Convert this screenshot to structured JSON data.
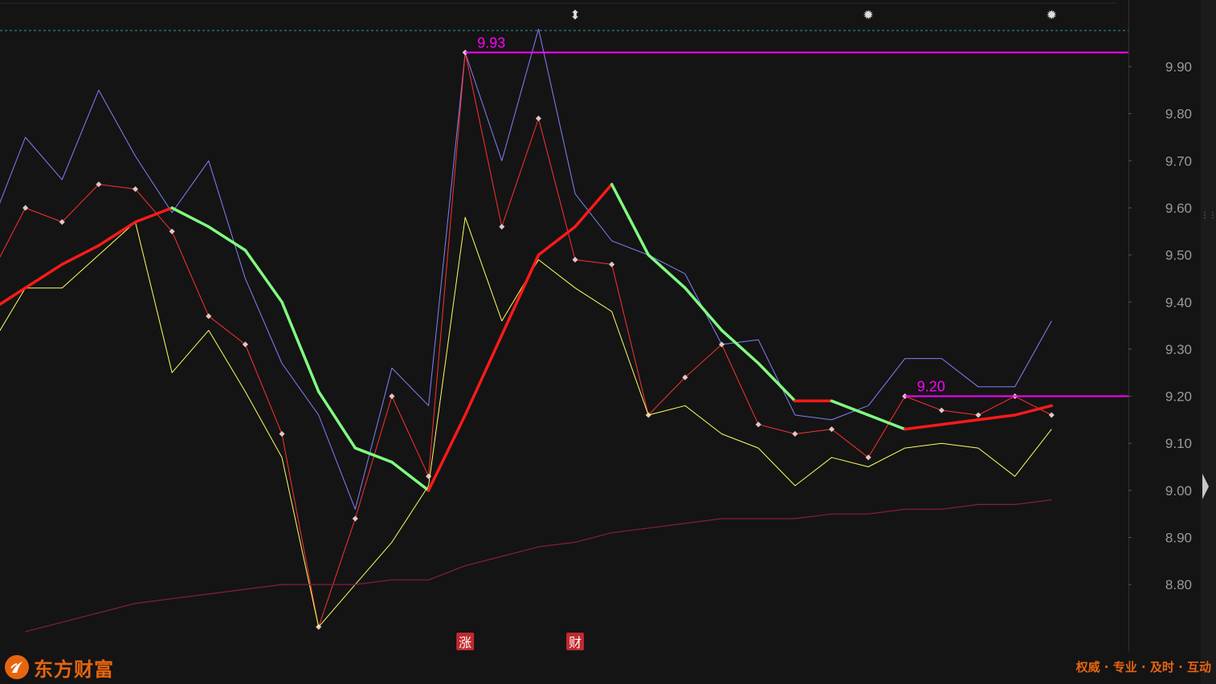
{
  "chart_data": {
    "type": "line",
    "ylim": [
      8.7,
      10.0
    ],
    "yticks": [
      "9.90",
      "9.80",
      "9.70",
      "9.60",
      "9.50",
      "9.40",
      "9.30",
      "9.20",
      "9.10",
      "9.00",
      "8.90",
      "8.80"
    ],
    "grid": false,
    "series": [
      {
        "color": "#8080ff",
        "width": 1,
        "values": [
          9.55,
          9.75,
          9.66,
          9.85,
          9.71,
          9.59,
          9.7,
          9.45,
          9.27,
          9.16,
          8.96,
          9.26,
          9.18,
          9.93,
          9.7,
          9.98,
          9.63,
          9.53,
          9.5,
          9.46,
          9.31,
          9.32,
          9.16,
          9.15,
          9.18,
          9.28,
          9.28,
          9.22,
          9.22,
          9.36
        ]
      },
      {
        "color": "#ff3030",
        "width": 1,
        "markers": true,
        "values": [
          9.45,
          9.6,
          9.57,
          9.65,
          9.64,
          9.55,
          9.37,
          9.31,
          9.12,
          8.71,
          8.94,
          9.2,
          9.03,
          9.93,
          9.56,
          9.79,
          9.49,
          9.48,
          9.16,
          9.24,
          9.31,
          9.14,
          9.12,
          9.13,
          9.07,
          9.2,
          9.17,
          9.16,
          9.2,
          9.16
        ]
      },
      {
        "color": "#ffff60",
        "width": 1,
        "values": [
          9.3,
          9.43,
          9.43,
          9.5,
          9.57,
          9.25,
          9.34,
          9.21,
          9.07,
          8.71,
          8.8,
          8.89,
          9.01,
          9.58,
          9.36,
          9.49,
          9.43,
          9.38,
          9.16,
          9.18,
          9.12,
          9.09,
          9.01,
          9.07,
          9.05,
          9.09,
          9.1,
          9.09,
          9.03,
          9.13
        ]
      },
      {
        "color": "#8a1a4a",
        "width": 1.2,
        "start": 1,
        "values": [
          null,
          8.7,
          8.72,
          8.74,
          8.76,
          8.77,
          8.78,
          8.79,
          8.8,
          8.8,
          8.8,
          8.81,
          8.81,
          8.84,
          8.86,
          8.88,
          8.89,
          8.91,
          8.92,
          8.93,
          8.94,
          8.94,
          8.94,
          8.95,
          8.95,
          8.96,
          8.96,
          8.97,
          8.97,
          8.98
        ]
      },
      {
        "type": "up-down",
        "up_color": "#ff1a1a",
        "down_color": "#80ff80",
        "width": 3.5,
        "values": [
          9.38,
          9.43,
          9.48,
          9.52,
          9.57,
          9.6,
          9.56,
          9.51,
          9.4,
          9.21,
          9.09,
          9.06,
          9.0,
          9.16,
          9.33,
          9.5,
          9.56,
          9.65,
          9.5,
          9.43,
          9.34,
          9.27,
          9.19,
          9.19,
          9.16,
          9.13,
          9.14,
          9.15,
          9.16,
          9.18
        ]
      }
    ],
    "hlines": [
      {
        "value": 9.93,
        "label": "9.93",
        "color": "#ff00ff",
        "from_index": 13
      },
      {
        "value": 9.2,
        "label": "9.20",
        "color": "#ff00ff",
        "from_index": 25
      }
    ],
    "event_markers": [
      {
        "index": 13,
        "label": "涨",
        "color": "#c0292e"
      },
      {
        "index": 16,
        "label": "财",
        "color": "#c0292e"
      }
    ],
    "top_icons": [
      {
        "index": 16,
        "icon": "up-down-arrow-icon",
        "glyph": "⬍"
      },
      {
        "index": 24,
        "icon": "gear-icon",
        "glyph": "✹"
      },
      {
        "index": 29,
        "icon": "gear-icon",
        "glyph": "✹"
      }
    ]
  },
  "brand": {
    "name": "东方财富",
    "slogan": "权威 · 专业 · 及时 · 互动",
    "color": "#e8650f"
  }
}
